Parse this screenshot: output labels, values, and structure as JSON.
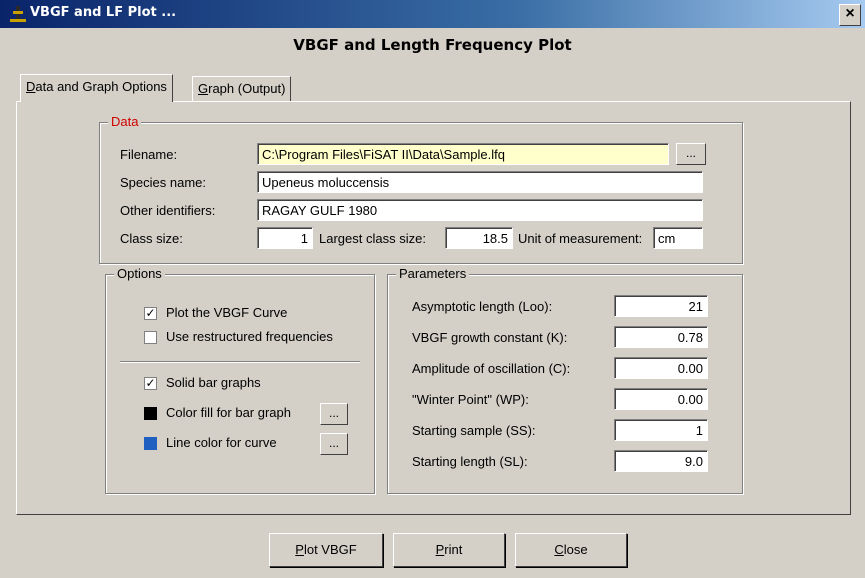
{
  "window": {
    "title": "VBGF and LF Plot ...",
    "close_glyph": "×"
  },
  "heading": "VBGF and Length Frequency Plot",
  "tabs": [
    {
      "label": "Data and Graph Options",
      "underline": "D",
      "rest": "ata and Graph Options",
      "active": true
    },
    {
      "label": "Graph (Output)",
      "underline": "G",
      "rest": "raph (Output)",
      "active": false
    }
  ],
  "data_group": {
    "title": "Data",
    "filename_label": "Filename:",
    "filename_value": "C:\\Program Files\\FiSAT II\\Data\\Sample.lfq",
    "browse_label": "...",
    "species_label": "Species name:",
    "species_value": "Upeneus moluccensis",
    "identifiers_label": "Other identifiers:",
    "identifiers_value": "RAGAY GULF 1980",
    "class_size_label": "Class size:",
    "class_size_value": "1",
    "largest_label": "Largest class size:",
    "largest_value": "18.5",
    "unit_label": "Unit of measurement:",
    "unit_value": "cm"
  },
  "options_group": {
    "title": "Options",
    "plot_vbgf": {
      "label": "Plot the VBGF Curve",
      "checked": true
    },
    "restructured": {
      "label": "Use restructured frequencies",
      "checked": false
    },
    "solid_bar": {
      "label": "Solid bar graphs",
      "checked": true
    },
    "fill_color": {
      "label": "Color fill for bar graph",
      "color": "#000000",
      "button": "..."
    },
    "line_color": {
      "label": "Line color for curve",
      "color": "#1f5fbf",
      "button": "..."
    },
    "check_glyph": "✓"
  },
  "parameters_group": {
    "title": "Parameters",
    "rows": [
      {
        "label": "Asymptotic length (Loo):",
        "value": "21"
      },
      {
        "label": "VBGF growth constant (K):",
        "value": "0.78"
      },
      {
        "label": "Amplitude of oscillation (C):",
        "value": "0.00"
      },
      {
        "label": "\"Winter Point\" (WP):",
        "value": "0.00"
      },
      {
        "label": "Starting sample (SS):",
        "value": "1"
      },
      {
        "label": "Starting length (SL):",
        "value": "9.0"
      }
    ]
  },
  "buttons": {
    "plot": {
      "underline": "P",
      "rest": "lot VBGF"
    },
    "print": {
      "underline": "P",
      "rest": "rint"
    },
    "close": {
      "underline": "C",
      "rest": "lose"
    }
  }
}
